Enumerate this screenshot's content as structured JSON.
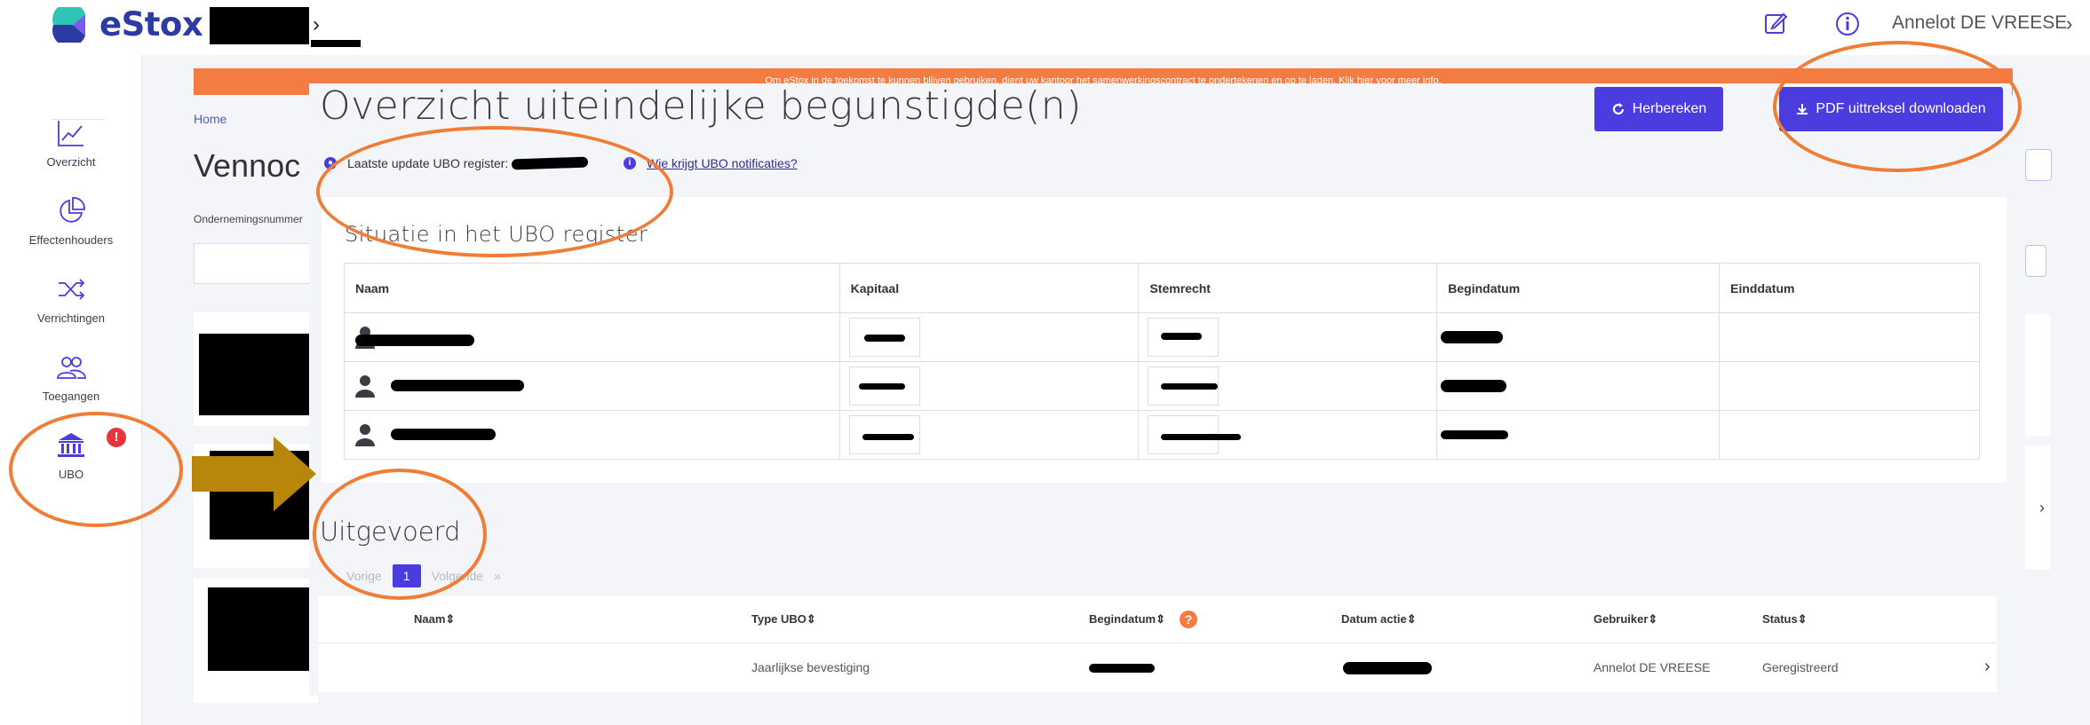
{
  "app": {
    "name": "eStox",
    "breadcrumb_chevron": "›"
  },
  "header": {
    "user_name": "Annelot DE VREESE",
    "user_chevron": "›"
  },
  "sidebar": {
    "items": [
      {
        "label": "Overzicht",
        "icon": "chart-line-icon"
      },
      {
        "label": "Effectenhouders",
        "icon": "pie-chart-icon"
      },
      {
        "label": "Verrichtingen",
        "icon": "shuffle-icon"
      },
      {
        "label": "Toegangen",
        "icon": "users-icon"
      },
      {
        "label": "UBO",
        "icon": "bank-icon",
        "badge": "!"
      }
    ]
  },
  "banner": {
    "text": "Om eStox in de toekomst te kunnen blijven gebruiken, dient uw kantoor het samenwerkingscontract te ondertekenen en op te laden. Klik hier voor meer info."
  },
  "background": {
    "home": "Home",
    "title": "Vennoc",
    "field_label": "Ondernemingsnummer"
  },
  "modal": {
    "title": "Overzicht uiteindelijke begunstigde(n)",
    "btn_recalc": "Herbereken",
    "btn_pdf": "PDF uittreksel downloaden",
    "last_update": "Laatste update UBO register:",
    "notif_link": "Wie krijgt UBO notificaties?",
    "register_title": "Situatie in het UBO register",
    "columns": [
      "Naam",
      "Kapitaal",
      "Stemrecht",
      "Begindatum",
      "Einddatum"
    ]
  },
  "executed": {
    "title": "Uitgevoerd",
    "pager": {
      "prev": "Vorige",
      "page": "1",
      "next": "Volgende",
      "next_arrow": "»"
    },
    "columns": [
      "Naam⇕",
      "Type UBO⇕",
      "Begindatum⇕",
      "Datum actie⇕",
      "Gebruiker⇕",
      "Status⇕"
    ],
    "help": "?",
    "row": {
      "type": "Jaarlijkse bevestiging",
      "user": "Annelot DE VREESE",
      "status": "Geregistreerd",
      "chevron": "›"
    }
  },
  "colors": {
    "accent": "#4b3ce0",
    "banner": "#f47c42",
    "annotation": "#ef7d36",
    "arrow": "#b8860b"
  }
}
